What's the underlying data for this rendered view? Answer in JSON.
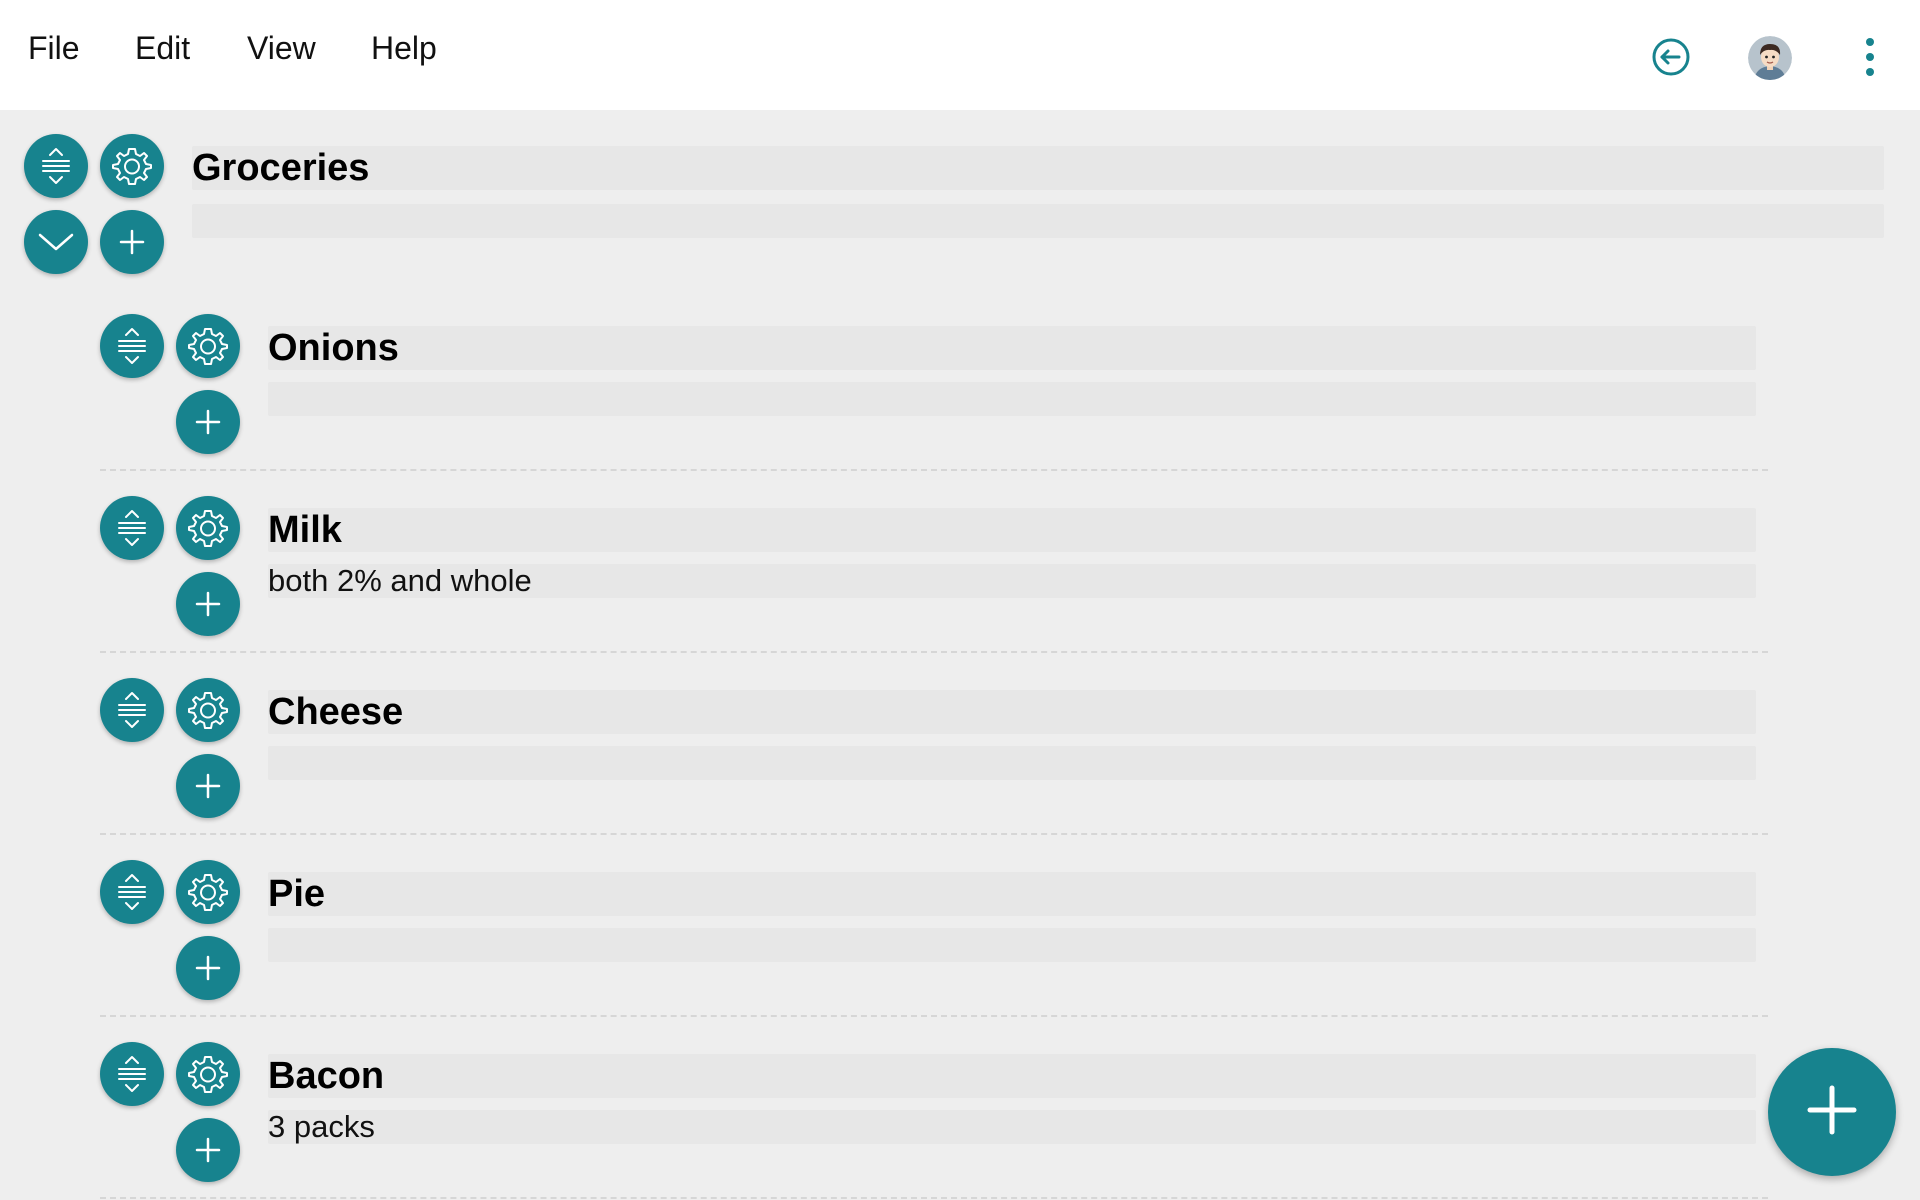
{
  "menu": {
    "file": "File",
    "edit": "Edit",
    "view": "View",
    "help": "Help"
  },
  "header_icons": [
    "back-arrow-circle-icon",
    "user-avatar",
    "more-vertical-icon"
  ],
  "colors": {
    "accent": "#17838e",
    "background": "#eeeeee",
    "topbar": "#ffffff",
    "field": "#e7e7e7"
  },
  "list": {
    "title": "Groceries",
    "note": ""
  },
  "items": [
    {
      "title": "Onions",
      "note": ""
    },
    {
      "title": "Milk",
      "note": "both 2% and whole"
    },
    {
      "title": "Cheese",
      "note": ""
    },
    {
      "title": "Pie",
      "note": ""
    },
    {
      "title": "Bacon",
      "note": "3 packs"
    }
  ]
}
